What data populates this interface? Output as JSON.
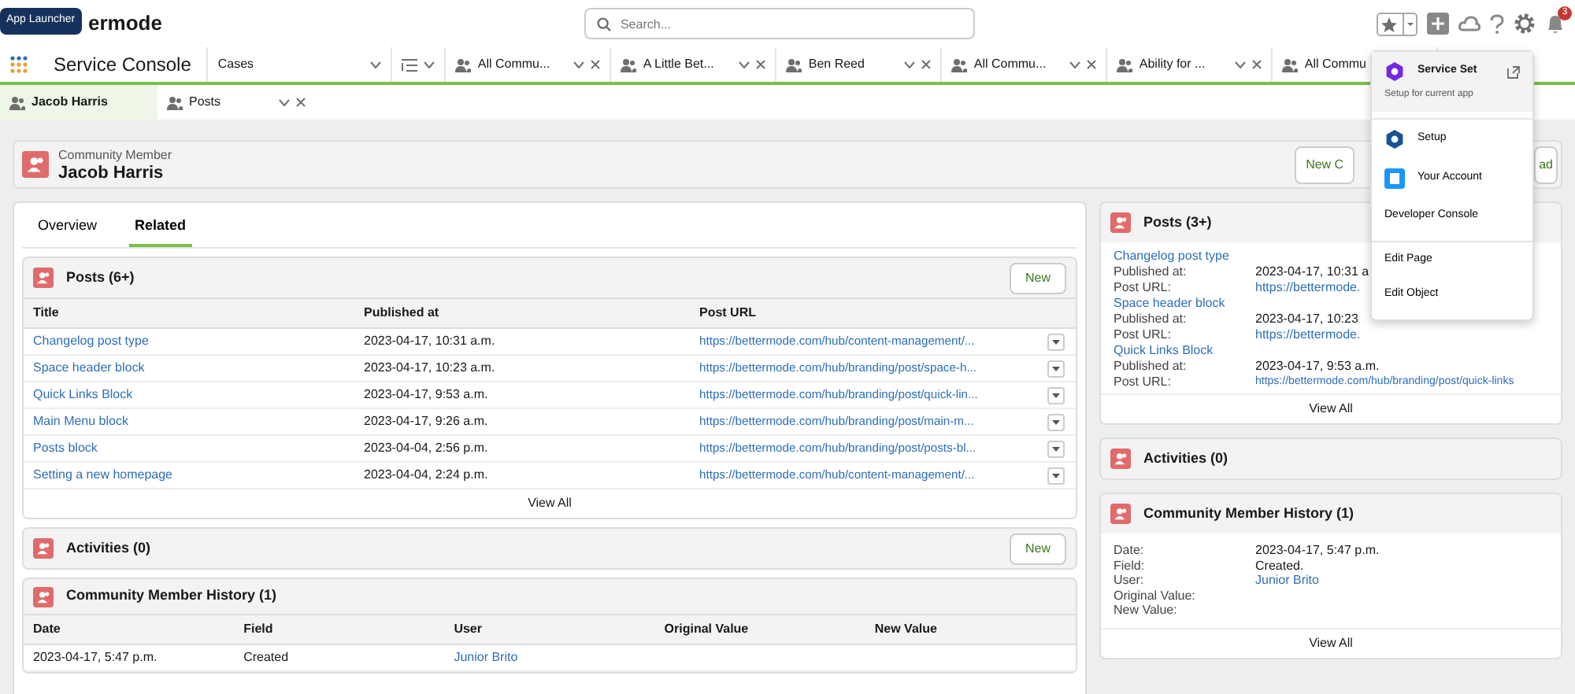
{
  "header": {
    "logo_text": "ermode",
    "tooltip": "App Launcher",
    "search": {
      "placeholder": "Search..."
    },
    "notification_count": "3"
  },
  "nav": {
    "app_name": "Service Console",
    "object_menu": "Cases",
    "tabs": [
      {
        "label": "All Commu...",
        "closable": true
      },
      {
        "label": "A Little Bet...",
        "closable": true
      },
      {
        "label": "Ben Reed",
        "closable": true
      },
      {
        "label": "All Commu...",
        "closable": true
      },
      {
        "label": "Ability for ...",
        "closable": true
      },
      {
        "label": "All Commu"
      }
    ]
  },
  "subtabs": [
    {
      "label": "Jacob Harris",
      "selected": true,
      "closable": false
    },
    {
      "label": "Posts",
      "selected": false,
      "closable": true
    }
  ],
  "record": {
    "type": "Community Member",
    "name": "Jacob Harris",
    "buttons": [
      "New C",
      "ad"
    ]
  },
  "left": {
    "tabs": [
      {
        "label": "Overview",
        "selected": false
      },
      {
        "label": "Related",
        "selected": true
      }
    ],
    "posts": {
      "title": "Posts (6+)",
      "button": "New",
      "columns": [
        "Title",
        "Published at",
        "Post URL"
      ],
      "rows": [
        {
          "title": "Changelog post type",
          "published": "2023-04-17, 10:31 a.m.",
          "url": "https://bettermode.com/hub/content-management/..."
        },
        {
          "title": "Space header block",
          "published": "2023-04-17, 10:23 a.m.",
          "url": "https://bettermode.com/hub/branding/post/space-h..."
        },
        {
          "title": "Quick Links Block",
          "published": "2023-04-17, 9:53 a.m.",
          "url": "https://bettermode.com/hub/branding/post/quick-lin..."
        },
        {
          "title": "Main Menu block",
          "published": "2023-04-17, 9:26 a.m.",
          "url": "https://bettermode.com/hub/branding/post/main-m..."
        },
        {
          "title": "Posts block",
          "published": "2023-04-04, 2:56 p.m.",
          "url": "https://bettermode.com/hub/branding/post/posts-bl..."
        },
        {
          "title": "Setting a new homepage",
          "published": "2023-04-04, 2:24 p.m.",
          "url": "https://bettermode.com/hub/content-management/..."
        }
      ],
      "view_all": "View All"
    },
    "activities": {
      "title": "Activities (0)",
      "button": "New"
    },
    "history": {
      "title": "Community Member History (1)",
      "columns": [
        "Date",
        "Field",
        "User",
        "Original Value",
        "New Value"
      ],
      "rows": [
        {
          "date": "2023-04-17, 5:47 p.m.",
          "field": "Created",
          "user": "Junior Brito"
        }
      ]
    }
  },
  "right": {
    "posts": {
      "title": "Posts (3+)",
      "items": [
        {
          "title": "Changelog post type",
          "fields": [
            {
              "label": "Published at:",
              "value": "2023-04-17, 10:31 a",
              "link": false
            },
            {
              "label": "Post URL:",
              "value": "https://bettermode.",
              "link": true
            }
          ]
        },
        {
          "title": "Space header block",
          "fields": [
            {
              "label": "Published at:",
              "value": "2023-04-17, 10:23",
              "link": false
            },
            {
              "label": "Post URL:",
              "value": "https://bettermode.",
              "link": true
            }
          ]
        },
        {
          "title": "Quick Links Block",
          "fields": [
            {
              "label": "Published at:",
              "value": "2023-04-17, 9:53 a.m.",
              "link": false
            },
            {
              "label": "Post URL:",
              "value": "https://bettermode.com/hub/branding/post/quick-links",
              "link": true
            }
          ]
        }
      ],
      "view_all": "View All"
    },
    "activities": {
      "title": "Activities (0)"
    },
    "history": {
      "title": "Community Member History (1)",
      "fields": [
        {
          "label": "Date:",
          "value": "2023-04-17, 5:47 p.m.",
          "link": false
        },
        {
          "label": "Field:",
          "value": "Created.",
          "link": false
        },
        {
          "label": "User:",
          "value": "Junior Brito",
          "link": true
        },
        {
          "label": "Original Value:"
        },
        {
          "label": "New Value:"
        }
      ],
      "view_all": "View All"
    }
  },
  "menu": {
    "items": [
      {
        "kind": "featured",
        "label": "Service Set",
        "sublabel": "Setup for current app",
        "selected": true,
        "divider_before": false
      },
      {
        "kind": "gear",
        "label": "Setup",
        "selected": false,
        "divider_before": true
      },
      {
        "kind": "account",
        "label": "Your Account",
        "selected": false,
        "divider_before": false
      },
      {
        "kind": "plain",
        "label": "Developer Console",
        "selected": false,
        "divider_before": false
      },
      {
        "kind": "plain",
        "label": "Edit Page",
        "selected": false,
        "divider_before": true
      },
      {
        "kind": "plain",
        "label": "Edit Object",
        "selected": false,
        "divider_before": false
      }
    ]
  }
}
